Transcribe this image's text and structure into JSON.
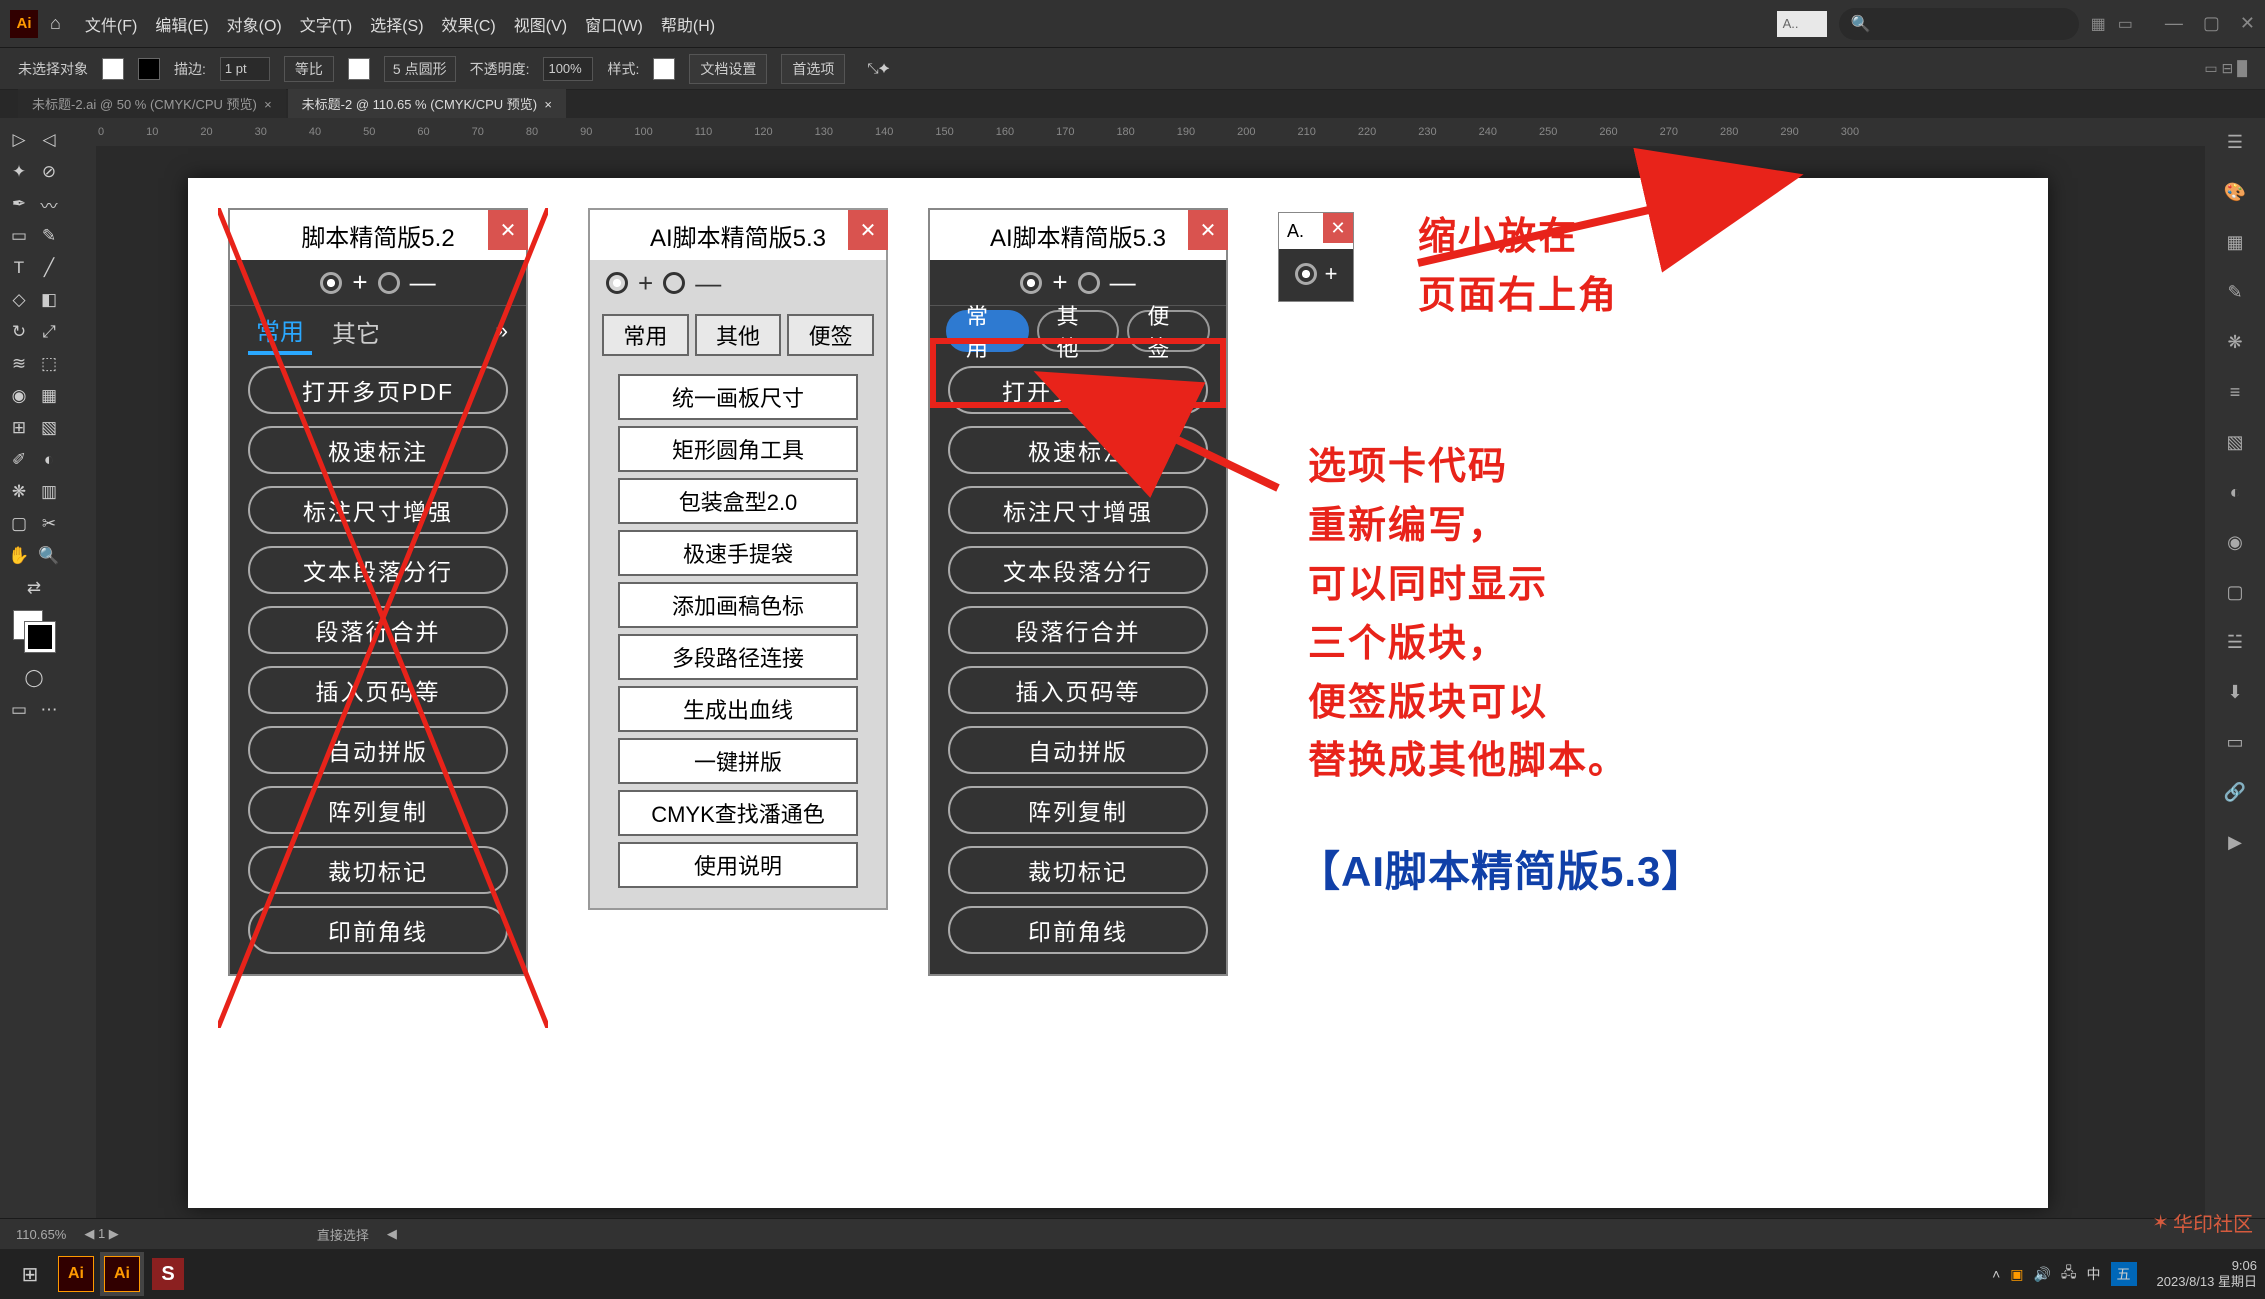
{
  "menubar": {
    "file": "文件(F)",
    "edit": "编辑(E)",
    "object": "对象(O)",
    "type": "文字(T)",
    "select": "选择(S)",
    "effect": "效果(C)",
    "view": "视图(V)",
    "window": "窗口(W)",
    "help": "帮助(H)"
  },
  "search_hint": "A..",
  "controlbar": {
    "noSel": "未选择对象",
    "stroke": "描边:",
    "strokeVal": "1 pt",
    "uniform": "等比",
    "ptRound": "5 点圆形",
    "opacity": "不透明度:",
    "opVal": "100%",
    "style": "样式:",
    "docSetup": "文档设置",
    "prefs": "首选项"
  },
  "doc_tabs": {
    "t1": "未标题-2.ai @ 50 % (CMYK/CPU 预览)",
    "t2": "未标题-2 @ 110.65 % (CMYK/CPU 预览)"
  },
  "ruler": [
    "0",
    "10",
    "20",
    "30",
    "40",
    "50",
    "60",
    "70",
    "80",
    "90",
    "100",
    "110",
    "120",
    "130",
    "140",
    "150",
    "160",
    "170",
    "180",
    "190",
    "200",
    "210",
    "220",
    "230",
    "240",
    "250",
    "260",
    "270",
    "280",
    "290",
    "300"
  ],
  "panel1": {
    "title": "脚本精简版5.2",
    "tabs": [
      "常用",
      "其它"
    ],
    "buttons": [
      "打开多页PDF",
      "极速标注",
      "标注尺寸增强",
      "文本段落分行",
      "段落行合并",
      "插入页码等",
      "自动拼版",
      "阵列复制",
      "裁切标记",
      "印前角线"
    ]
  },
  "panel2": {
    "title": "AI脚本精简版5.3",
    "tabs": [
      "常用",
      "其他",
      "便签"
    ],
    "buttons": [
      "统一画板尺寸",
      "矩形圆角工具",
      "包装盒型2.0",
      "极速手提袋",
      "添加画稿色标",
      "多段路径连接",
      "生成出血线",
      "一键拼版",
      "CMYK查找潘通色",
      "使用说明"
    ]
  },
  "panel3": {
    "title": "AI脚本精简版5.3",
    "tabs": [
      "常用",
      "其他",
      "便签"
    ],
    "buttons": [
      "打开多页PDF",
      "极速标注",
      "标注尺寸增强",
      "文本段落分行",
      "段落行合并",
      "插入页码等",
      "自动拼版",
      "阵列复制",
      "裁切标记",
      "印前角线"
    ]
  },
  "mini": {
    "label": "A."
  },
  "annotations": {
    "topRight": "缩小放在\n页面右上角",
    "main": "选项卡代码\n重新编写，\n可以同时显示\n三个版块，\n便签版块可以\n替换成其他脚本。",
    "bottom": "【AI脚本精简版5.3】"
  },
  "status": {
    "zoom": "110.65%",
    "mode": "直接选择"
  },
  "taskbar": {
    "time": "9:06",
    "date": "2023/8/13 星期日"
  },
  "watermark": "华印社区"
}
